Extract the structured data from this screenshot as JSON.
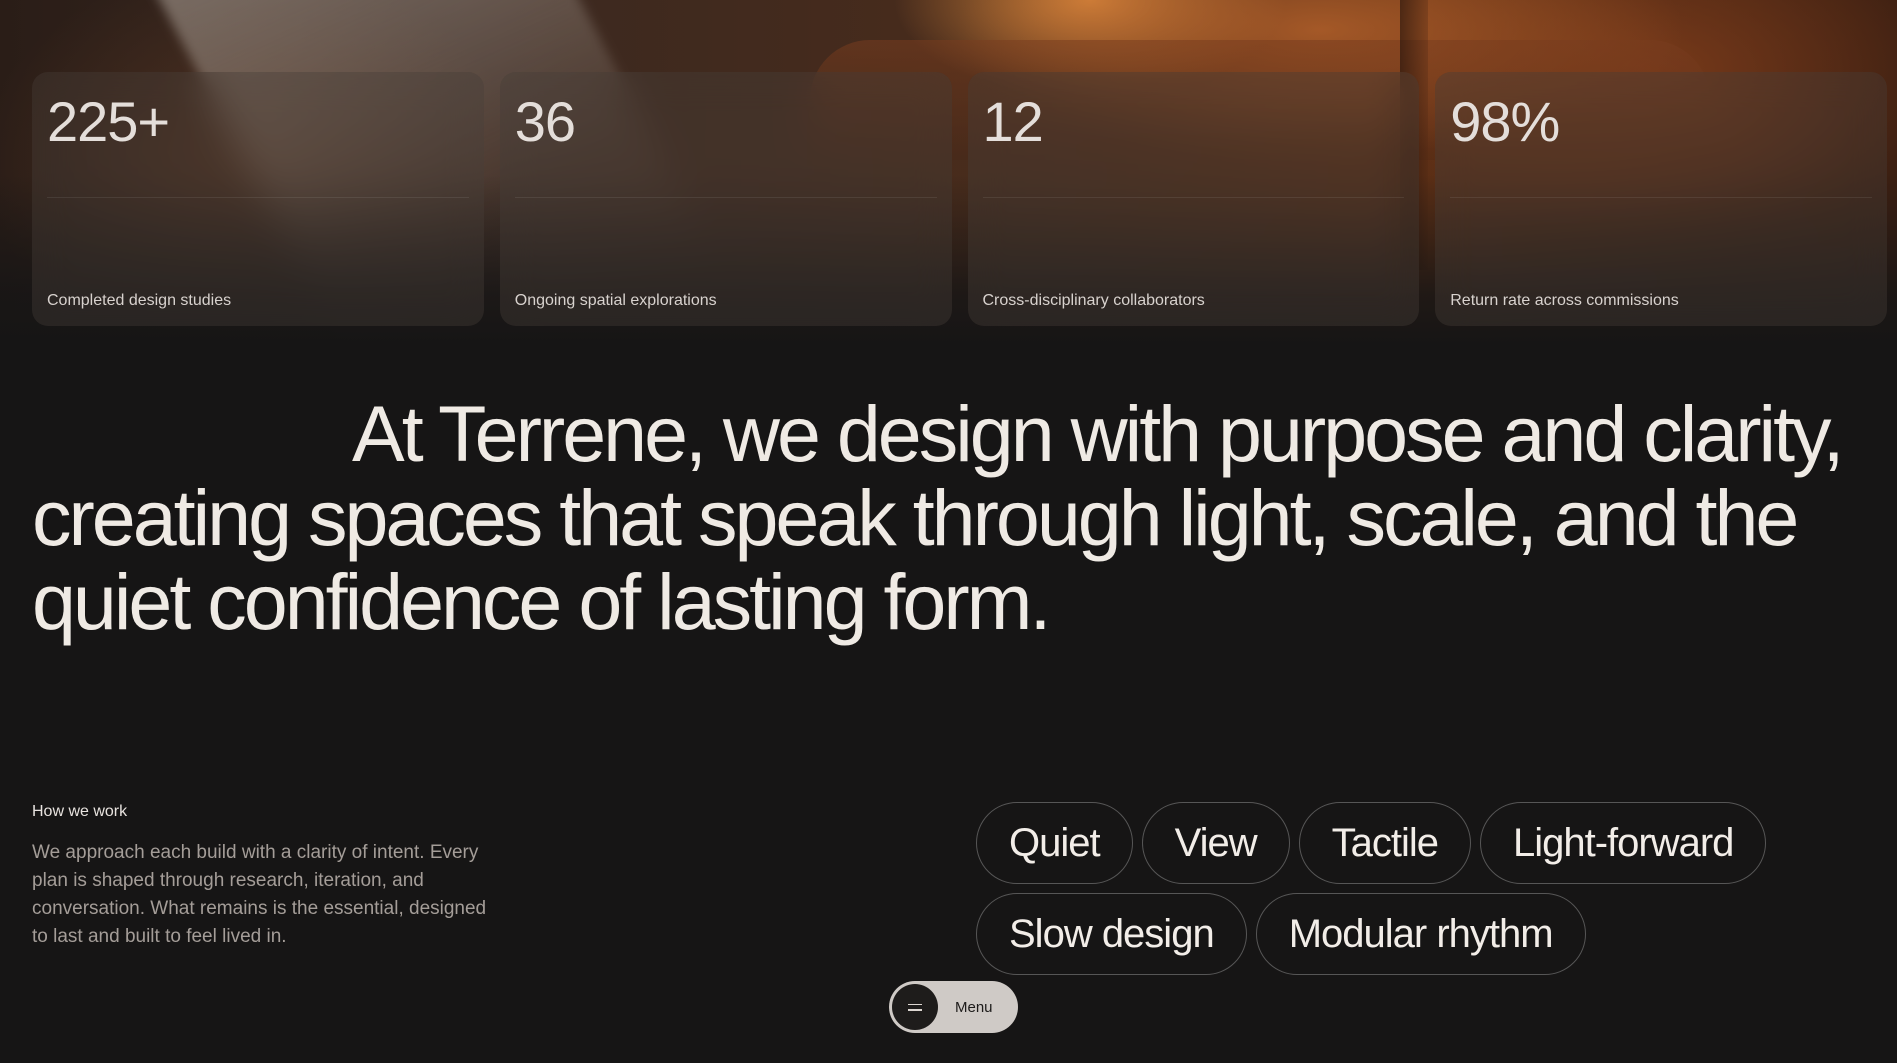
{
  "stats": [
    {
      "value": "225+",
      "label": "Completed design studies"
    },
    {
      "value": "36",
      "label": "Ongoing spatial explorations"
    },
    {
      "value": "12",
      "label": "Cross-disciplinary collaborators"
    },
    {
      "value": "98%",
      "label": "Return rate across commissions"
    }
  ],
  "statement": "At Terrene, we design with purpose and clarity, creating spaces that speak through light, scale, and the quiet confidence of lasting form.",
  "how_we_work": {
    "title": "How we work",
    "body": "We approach each build with a clarity of intent. Every plan is shaped through research, iteration, and conversation. What remains is the essential, designed to last and built to feel lived in."
  },
  "tags": [
    "Quiet",
    "View",
    "Tactile",
    "Light-forward",
    "Slow design",
    "Modular rhythm"
  ],
  "menu": {
    "label": "Menu",
    "icon": "hamburger-icon"
  },
  "colors": {
    "background": "#161515",
    "text_primary": "#efeae4",
    "text_muted": "#a49d98",
    "menu_pill": "#cfcac6"
  }
}
